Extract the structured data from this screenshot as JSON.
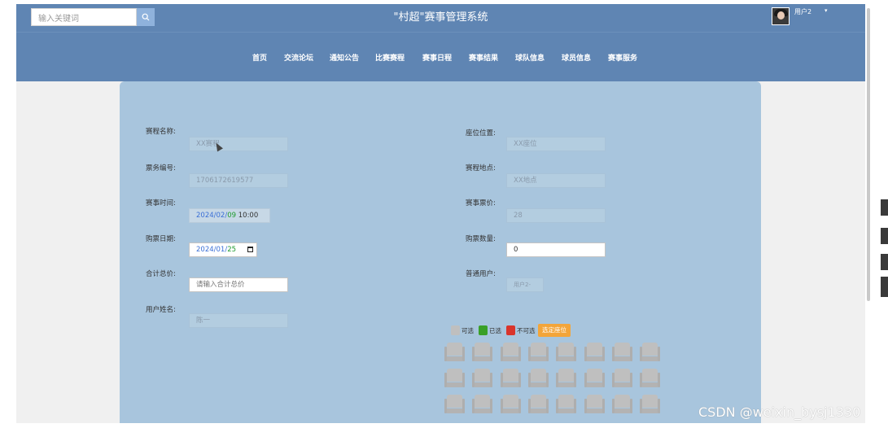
{
  "header": {
    "title": "\"村超\"赛事管理系统",
    "search_placeholder": "输入关键词",
    "search_icon": "search-icon",
    "user_name": "用户2",
    "user_caret": "▾"
  },
  "nav": {
    "items": [
      "首页",
      "交流论坛",
      "通知公告",
      "比赛赛程",
      "赛事日程",
      "赛事结果",
      "球队信息",
      "球员信息",
      "赛事服务"
    ]
  },
  "form": {
    "event_name_label": "赛程名称:",
    "event_name_value": "XX赛程",
    "ticket_no_label": "票务编号:",
    "ticket_no_value": "1706172619577",
    "match_time_label": "赛事时间:",
    "match_time_year": "2024",
    "match_time_month": "02",
    "match_time_day": "09",
    "match_time_clock": "10:00",
    "buy_date_label": "购票日期:",
    "buy_date_year": "2024",
    "buy_date_month": "01",
    "buy_date_day": "25",
    "total_label": "合计总价:",
    "total_placeholder": "请输入合计总价",
    "user_real_name_label": "用户姓名:",
    "user_real_name_value": "陈一",
    "seat_pos_label": "座位位置:",
    "seat_pos_value": "XX座位",
    "venue_label": "赛程地点:",
    "venue_value": "XX地点",
    "price_label": "赛事票价:",
    "price_value": "28",
    "qty_label": "购票数量:",
    "qty_value": "0",
    "normal_user_label": "普通用户:",
    "normal_user_value": "用户2-",
    "date_sep": "/"
  },
  "legend": {
    "available": "可选",
    "selected": "已选",
    "unavailable": "不可选",
    "pick_button": "选定座位",
    "colors": {
      "available": "#bfbfbf",
      "selected": "#3aa028",
      "unavailable": "#d9342b"
    }
  },
  "seats": {
    "rows": 3,
    "cols": 8
  },
  "watermark": "CSDN @weixin_bysj1330"
}
